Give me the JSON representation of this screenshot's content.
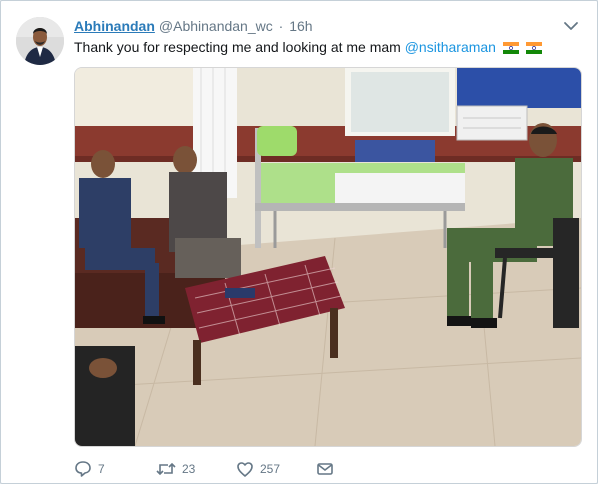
{
  "tweet": {
    "author_name": "Abhinandan",
    "author_handle": "@Abhinandan_wc",
    "separator": "·",
    "timestamp": "16h",
    "text": "Thank you for respecting me and looking at me mam ",
    "mention": "@nsitharaman",
    "flag_emoji": "indian-flag"
  },
  "actions": {
    "reply_count": "7",
    "retweet_count": "23",
    "like_count": "257"
  },
  "colors": {
    "link": "#1b95e0",
    "name": "#2b7bb9",
    "muted": "#657786"
  }
}
